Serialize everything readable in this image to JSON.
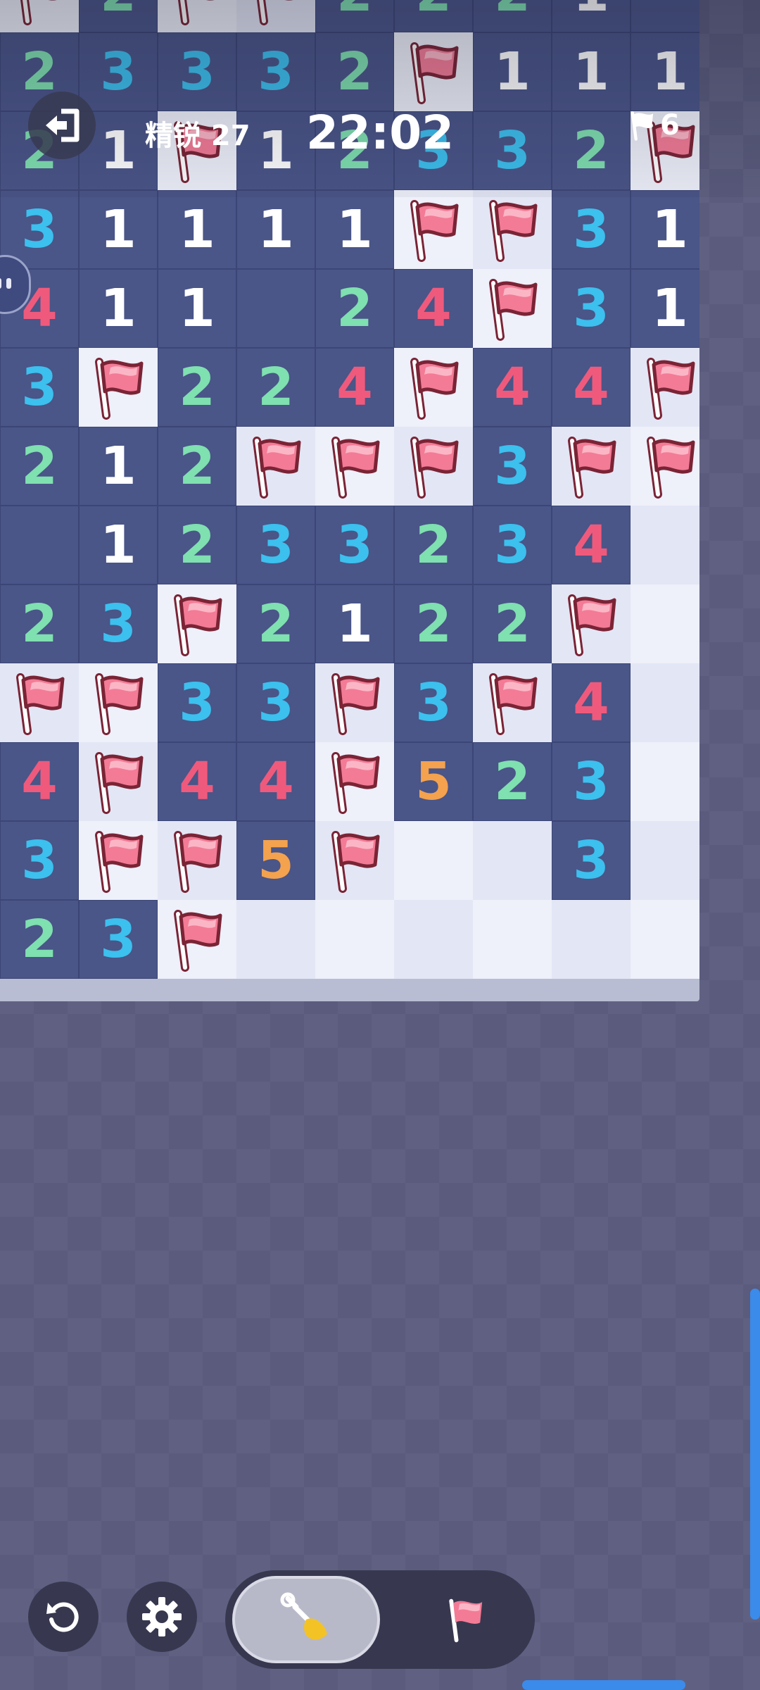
{
  "header": {
    "level_label": "精锐 27",
    "timer": "22:02",
    "flags_remaining": "6"
  },
  "colors": {
    "num_1": "#ffffff",
    "num_2": "#7fe0b0",
    "num_3": "#3cc0ee",
    "num_4": "#ef5a7c",
    "num_5": "#f4a24e",
    "accent": "#3b8bea"
  },
  "icons": {
    "exit": "exit-icon",
    "flag": "flag-icon",
    "restart": "restart-icon",
    "settings": "gear-icon",
    "dig": "shovel-icon"
  },
  "board": {
    "rows": [
      [
        "F",
        "2",
        "F",
        "F",
        "2",
        "2",
        "2",
        "1",
        ""
      ],
      [
        "2",
        "3",
        "3",
        "3",
        "2",
        "F",
        "1",
        "1",
        "1"
      ],
      [
        "2",
        "1",
        "F",
        "1",
        "2",
        "3",
        "3",
        "2",
        "F"
      ],
      [
        "3",
        "1",
        "1",
        "1",
        "1",
        "F",
        "F",
        "3",
        "1"
      ],
      [
        "4",
        "1",
        "1",
        "",
        "2",
        "4",
        "F",
        "3",
        "1"
      ],
      [
        "3",
        "F",
        "2",
        "2",
        "4",
        "F",
        "4",
        "4",
        "F"
      ],
      [
        "2",
        "1",
        "2",
        "F",
        "F",
        "F",
        "3",
        "F",
        "F"
      ],
      [
        "",
        "1",
        "2",
        "3",
        "3",
        "2",
        "3",
        "4",
        "H"
      ],
      [
        "2",
        "3",
        "F",
        "2",
        "1",
        "2",
        "2",
        "F",
        "H"
      ],
      [
        "F",
        "F",
        "3",
        "3",
        "F",
        "3",
        "F",
        "4",
        "H"
      ],
      [
        "4",
        "F",
        "4",
        "4",
        "F",
        "5",
        "2",
        "3",
        "H"
      ],
      [
        "3",
        "F",
        "F",
        "5",
        "F",
        "H",
        "H",
        "3",
        "H"
      ],
      [
        "2",
        "3",
        "F",
        "H",
        "H",
        "H",
        "H",
        "H",
        "H"
      ]
    ]
  }
}
